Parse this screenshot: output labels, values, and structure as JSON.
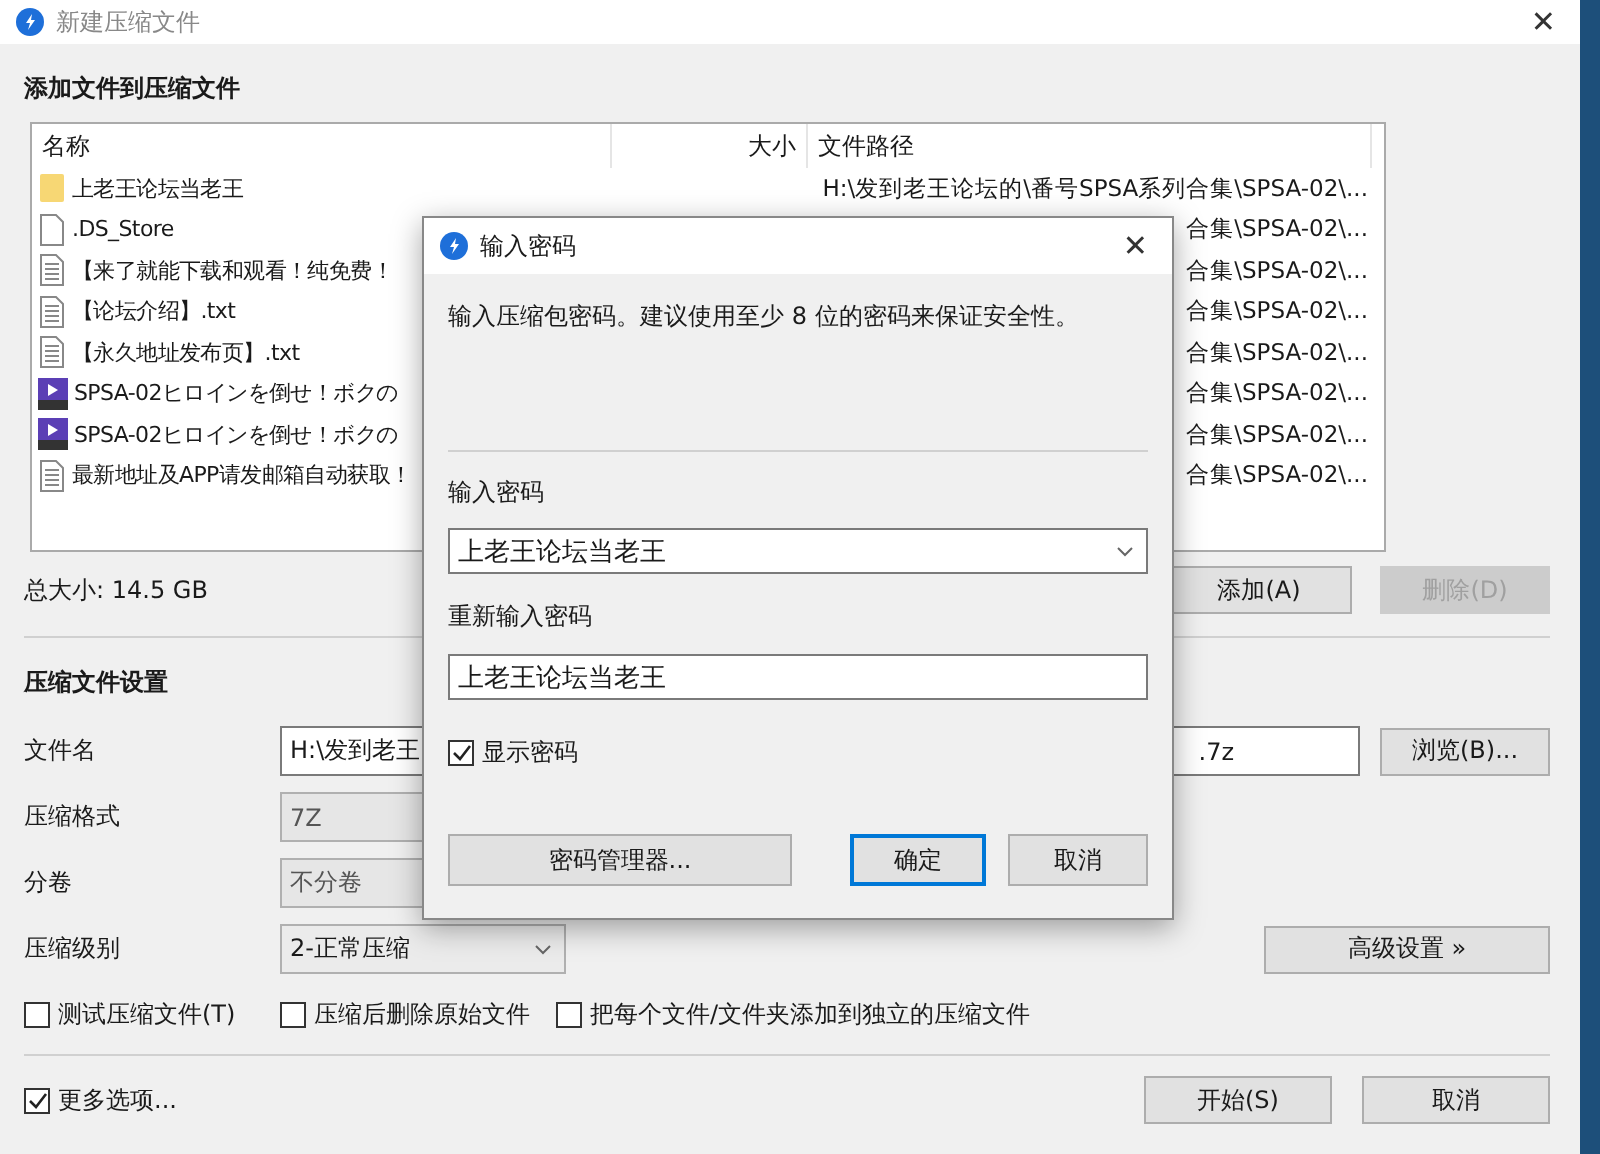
{
  "window": {
    "title": "新建压缩文件",
    "close_button": "✕"
  },
  "files": {
    "heading": "添加文件到压缩文件",
    "columns": [
      "名称",
      "大小",
      "文件路径"
    ],
    "rows": [
      {
        "kind": "folder",
        "name": "上老王论坛当老王",
        "path": "H:\\发到老王论坛的\\番号SPSA系列合集\\SPSA-02\\..."
      },
      {
        "kind": "file",
        "name": ".DS_Store",
        "path": "合集\\SPSA-02\\..."
      },
      {
        "kind": "text",
        "name": "【来了就能下载和观看！纯免费！",
        "path": "合集\\SPSA-02\\..."
      },
      {
        "kind": "text",
        "name": "【论坛介绍】.txt",
        "path": "合集\\SPSA-02\\..."
      },
      {
        "kind": "text",
        "name": "【永久地址发布页】.txt",
        "path": "合集\\SPSA-02\\..."
      },
      {
        "kind": "video",
        "name": "SPSA-02ヒロインを倒せ！ボクの",
        "path": "合集\\SPSA-02\\..."
      },
      {
        "kind": "video",
        "name": "SPSA-02ヒロインを倒せ！ボクの",
        "path": "合集\\SPSA-02\\..."
      },
      {
        "kind": "text",
        "name": "最新地址及APP请发邮箱自动获取！",
        "path": "合集\\SPSA-02\\..."
      }
    ]
  },
  "total_size": "总大小: 14.5 GB",
  "list_buttons": [
    {
      "label": "添加(A)",
      "disabled": false
    },
    {
      "label": "删除(D)",
      "disabled": true
    }
  ],
  "settings": {
    "heading": "压缩文件设置",
    "fields": [
      {
        "kind": "text",
        "label": "文件名",
        "value_start": "H:\\发到老王",
        "value_end": ".7z"
      },
      {
        "kind": "select",
        "label": "压缩格式",
        "value": "7Z",
        "disabled": true
      },
      {
        "kind": "select",
        "label": "分卷",
        "value": "不分卷",
        "disabled": true
      },
      {
        "kind": "select",
        "label": "压缩级别",
        "value": "2-正常压缩",
        "disabled": false
      }
    ],
    "browse_button": "浏览(B)...",
    "advanced_button": "高级设置 »"
  },
  "options": [
    {
      "label": "测试压缩文件(T)",
      "checked": false
    },
    {
      "label": "压缩后删除原始文件",
      "checked": false
    },
    {
      "label": "把每个文件/文件夹添加到独立的压缩文件",
      "checked": false
    }
  ],
  "more_options": {
    "label": "更多选项...",
    "checked": true
  },
  "footer_buttons": [
    "开始(S)",
    "取消"
  ],
  "dialog": {
    "title": "输入密码",
    "close_button": "✕",
    "description": "输入压缩包密码。建议使用至少 8 位的密码来保证安全性。",
    "password_label": "输入密码",
    "password": "上老王论坛当老王",
    "confirm_label": "重新输入密码",
    "confirm": "上老王论坛当老王",
    "show_password": {
      "label": "显示密码",
      "checked": true
    },
    "manager_button": "密码管理器...",
    "ok_button": "确定",
    "cancel_button": "取消"
  }
}
